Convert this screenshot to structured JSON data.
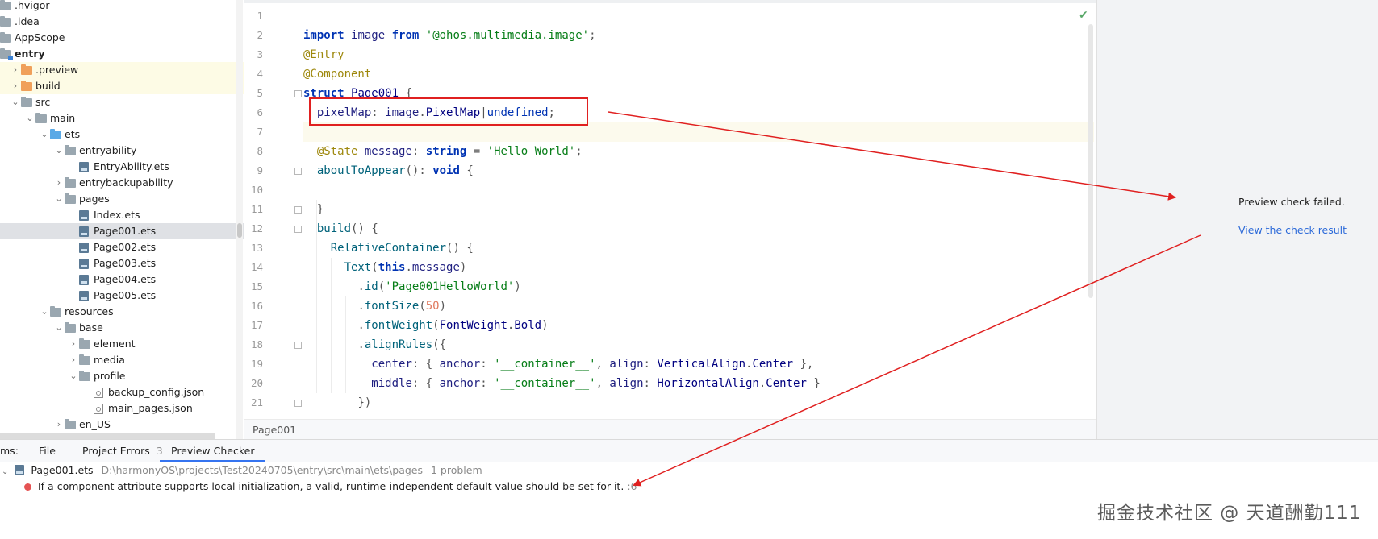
{
  "tree": {
    "items": [
      {
        "label": ".hvigor",
        "kind": "folder"
      },
      {
        "label": ".idea",
        "kind": "folder"
      },
      {
        "label": "AppScope",
        "kind": "folder"
      },
      {
        "label": "entry",
        "kind": "module"
      },
      {
        "label": ".preview",
        "kind": "folder-orange"
      },
      {
        "label": "build",
        "kind": "folder-orange"
      },
      {
        "label": "src",
        "kind": "folder"
      },
      {
        "label": "main",
        "kind": "folder"
      },
      {
        "label": "ets",
        "kind": "folder-blue"
      },
      {
        "label": "entryability",
        "kind": "folder"
      },
      {
        "label": "EntryAbility.ets",
        "kind": "file"
      },
      {
        "label": "entrybackupability",
        "kind": "folder"
      },
      {
        "label": "pages",
        "kind": "folder"
      },
      {
        "label": "Index.ets",
        "kind": "file"
      },
      {
        "label": "Page001.ets",
        "kind": "file"
      },
      {
        "label": "Page002.ets",
        "kind": "file"
      },
      {
        "label": "Page003.ets",
        "kind": "file"
      },
      {
        "label": "Page004.ets",
        "kind": "file"
      },
      {
        "label": "Page005.ets",
        "kind": "file"
      },
      {
        "label": "resources",
        "kind": "folder"
      },
      {
        "label": "base",
        "kind": "folder"
      },
      {
        "label": "element",
        "kind": "folder"
      },
      {
        "label": "media",
        "kind": "folder"
      },
      {
        "label": "profile",
        "kind": "folder"
      },
      {
        "label": "backup_config.json",
        "kind": "json"
      },
      {
        "label": "main_pages.json",
        "kind": "json"
      },
      {
        "label": "en_US",
        "kind": "folder"
      }
    ]
  },
  "editor": {
    "line_numbers": [
      "1",
      "2",
      "3",
      "4",
      "5",
      "6",
      "7",
      "8",
      "9",
      "10",
      "11",
      "12",
      "13",
      "14",
      "15",
      "16",
      "17",
      "18",
      "19",
      "20",
      "21"
    ],
    "lines": [
      "",
      "import image from '@ohos.multimedia.image';",
      "@Entry",
      "@Component",
      "struct Page001 {",
      "  pixelMap: image.PixelMap|undefined;",
      "",
      "  @State message: string = 'Hello World';",
      "  aboutToAppear(): void {",
      "",
      "  }",
      "  build() {",
      "    RelativeContainer() {",
      "      Text(this.message)",
      "        .id('Page001HelloWorld')",
      "        .fontSize(50)",
      "        .fontWeight(FontWeight.Bold)",
      "        .alignRules({",
      "          center: { anchor: '__container__', align: VerticalAlign.Center },",
      "          middle: { anchor: '__container__', align: HorizontalAlign.Center }",
      "        })"
    ],
    "breadcrumb": "Page001",
    "status_icon": "check-icon"
  },
  "preview": {
    "message": "Preview check failed.",
    "link": "View the check result"
  },
  "problems": {
    "tabs_prefix": "ms:",
    "tabs": [
      {
        "label": "File",
        "count": ""
      },
      {
        "label": "Project Errors",
        "count": "3"
      },
      {
        "label": "Preview Checker",
        "count": ""
      }
    ],
    "file_name": "Page001.ets",
    "file_path": "D:\\harmonyOS\\projects\\Test20240705\\entry\\src\\main\\ets\\pages",
    "file_count": "1 problem",
    "message": "If a component attribute supports local initialization, a valid, runtime-independent default value should be set for it.",
    "message_loc": ":6"
  },
  "watermark": "掘金技术社区 @ 天道酬勤111",
  "colors": {
    "accent": "#3574f0",
    "error": "#e55353",
    "annotation_red": "#e02020",
    "link": "#2e6bd9"
  }
}
